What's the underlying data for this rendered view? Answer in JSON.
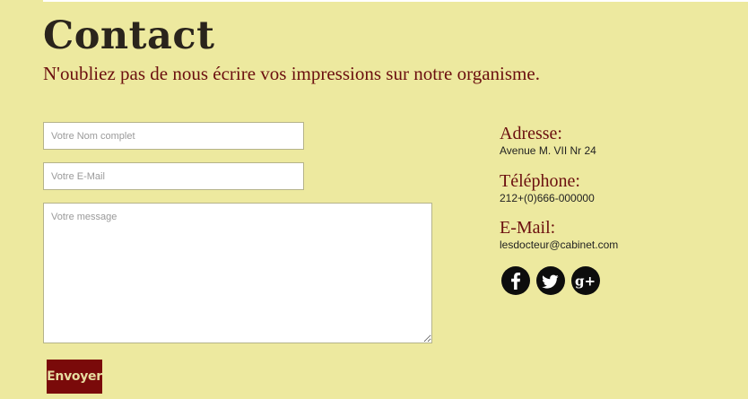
{
  "header": {
    "title": "Contact",
    "subtitle": "N'oubliez pas de nous écrire vos impressions sur notre organisme."
  },
  "form": {
    "name_placeholder": "Votre Nom complet",
    "email_placeholder": "Votre E-Mail",
    "message_placeholder": "Votre message",
    "submit_label": "Envoyer"
  },
  "info": {
    "address_label": "Adresse:",
    "address_value": "Avenue M. VII Nr 24",
    "phone_label": "Téléphone:",
    "phone_value": "212+(0)666-000000",
    "email_label": "E-Mail:",
    "email_value": "lesdocteur@cabinet.com"
  },
  "social": [
    {
      "icon": "facebook-icon"
    },
    {
      "icon": "twitter-icon"
    },
    {
      "icon": "google-plus-icon"
    }
  ],
  "colors": {
    "background": "#ede99f",
    "accent": "#6b0f0f",
    "button": "#7a0a0a",
    "button_text": "#e6dca0"
  }
}
